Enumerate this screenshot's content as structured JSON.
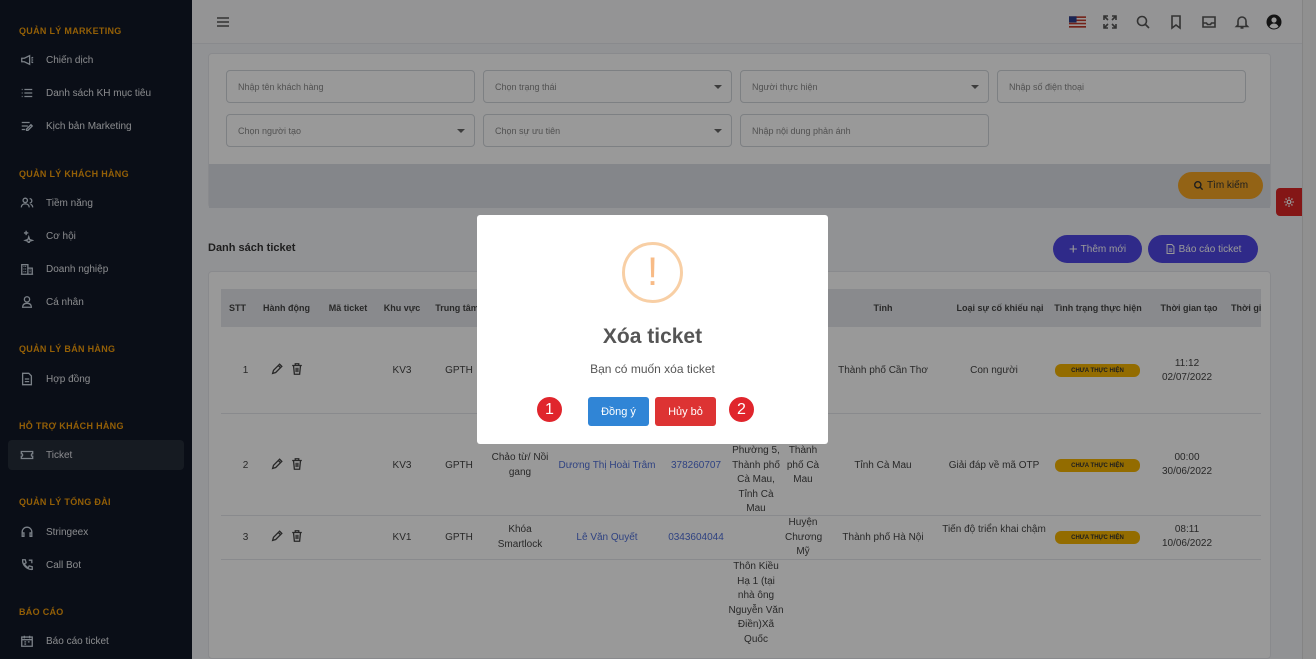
{
  "sidebar": {
    "sections": [
      {
        "title": "QUẢN LÝ MARKETING",
        "items": [
          {
            "label": "Chiến dịch",
            "icon": "megaphone-icon"
          },
          {
            "label": "Danh sách KH mục tiêu",
            "icon": "list-icon"
          },
          {
            "label": "Kịch bản Marketing",
            "icon": "edit-list-icon"
          }
        ]
      },
      {
        "title": "QUẢN LÝ KHÁCH HÀNG",
        "items": [
          {
            "label": "Tiềm năng",
            "icon": "users-icon"
          },
          {
            "label": "Cơ hội",
            "icon": "sparkle-icon"
          },
          {
            "label": "Doanh nghiệp",
            "icon": "building-icon"
          },
          {
            "label": "Cá nhân",
            "icon": "user-icon"
          }
        ]
      },
      {
        "title": "QUẢN LÝ BÁN HÀNG",
        "items": [
          {
            "label": "Hợp đồng",
            "icon": "document-icon"
          }
        ]
      },
      {
        "title": "HỖ TRỢ KHÁCH HÀNG",
        "items": [
          {
            "label": "Ticket",
            "icon": "ticket-icon",
            "active": true
          }
        ]
      },
      {
        "title": "QUẢN LÝ TỔNG ĐÀI",
        "items": [
          {
            "label": "Stringeex",
            "icon": "headset-icon"
          },
          {
            "label": "Call Bot",
            "icon": "phone-icon"
          }
        ]
      },
      {
        "title": "BÁO CÁO",
        "items": [
          {
            "label": "Báo cáo ticket",
            "icon": "calendar-icon"
          }
        ]
      }
    ]
  },
  "filters": {
    "customer_name": "Nhập tên khách hàng",
    "status": "Chọn trạng thái",
    "assignee": "Người thực hiện",
    "phone": "Nhập số điện thoại",
    "creator": "Chọn người tạo",
    "priority": "Chọn sự ưu tiên",
    "content": "Nhập nội dung phản ánh",
    "search_button": "Tìm kiếm"
  },
  "list": {
    "title": "Danh sách ticket",
    "add_button": "Thêm mới",
    "report_button": "Báo cáo ticket"
  },
  "table": {
    "headers": [
      "STT",
      "Hành động",
      "Mã ticket",
      "Khu vực",
      "Trung tâm",
      "Tỉnh",
      "Loại sự cố khiếu nại",
      "Tình trạng thực hiện",
      "Thời gian tạo",
      "Thời gi"
    ],
    "rows": [
      {
        "stt": "1",
        "area": "KV3",
        "center": "GPTH",
        "issue": "",
        "customer": "",
        "phone": "",
        "address": "",
        "district": "",
        "province": "Thành phố Cần Thơ",
        "type": "Con người",
        "status": "CHƯA THỰC HIỆN",
        "time": "11:12",
        "date": "02/07/2022"
      },
      {
        "stt": "2",
        "area": "KV3",
        "center": "GPTH",
        "issue": "Chảo từ/ Nồi gang",
        "customer": "Dương Thị Hoài Trâm",
        "phone": "378260707",
        "address": "Phường 5, Thành phố Cà Mau, Tỉnh Cà Mau",
        "district": "Thành phố Cà Mau",
        "province": "Tỉnh Cà Mau",
        "type": "Giải đáp về mã OTP",
        "status": "CHƯA THỰC HIỆN",
        "time": "00:00",
        "date": "30/06/2022"
      },
      {
        "stt": "3",
        "area": "KV1",
        "center": "GPTH",
        "issue": "Khóa Smartlock",
        "customer": "Lê Văn Quyết",
        "phone": "0343604044",
        "address": "",
        "district": "Huyện Chương Mỹ",
        "province": "Thành phố Hà Nội",
        "type": "Tiến độ triển khai chậm",
        "status": "CHƯA THỰC HIỆN",
        "time": "08:11",
        "date": "10/06/2022"
      },
      {
        "address": "Thôn Kiều Hạ 1 (tại nhà ông Nguyễn Văn Điền)Xã Quốc"
      }
    ]
  },
  "modal": {
    "icon": "!",
    "title": "Xóa ticket",
    "message": "Bạn có muốn xóa ticket",
    "confirm": "Đồng ý",
    "cancel": "Hủy bỏ",
    "marker1": "1",
    "marker2": "2"
  },
  "colors": {
    "sidebar_bg": "#111827",
    "section_title": "#f59e0b",
    "primary": "#4f46e5",
    "confirm": "#3085d6",
    "cancel": "#dd3333",
    "badge": "#f5b400"
  }
}
